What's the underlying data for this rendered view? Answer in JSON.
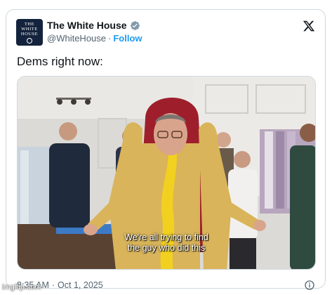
{
  "tweet": {
    "account": {
      "display_name": "The White House",
      "handle": "@WhiteHouse",
      "separator": "·",
      "follow_label": "Follow",
      "verified_color": "#829aab",
      "avatar_text": [
        "THE",
        "WHITE",
        "HOUSE"
      ]
    },
    "text": "Dems right now:",
    "media": {
      "subtitle_line1": "We're all trying to find",
      "subtitle_line2": "the guy who did this"
    },
    "time": "8:35 AM",
    "date_separator": "·",
    "date": "Oct 1, 2025"
  },
  "icons": {
    "brand": "x-logo-icon",
    "verified": "verified-badge-icon",
    "info": "info-icon"
  },
  "watermark": "imgflip.com",
  "colors": {
    "link": "#1d9bf0",
    "text": "#0f1419",
    "muted": "#536471",
    "border": "#cfd9de"
  }
}
